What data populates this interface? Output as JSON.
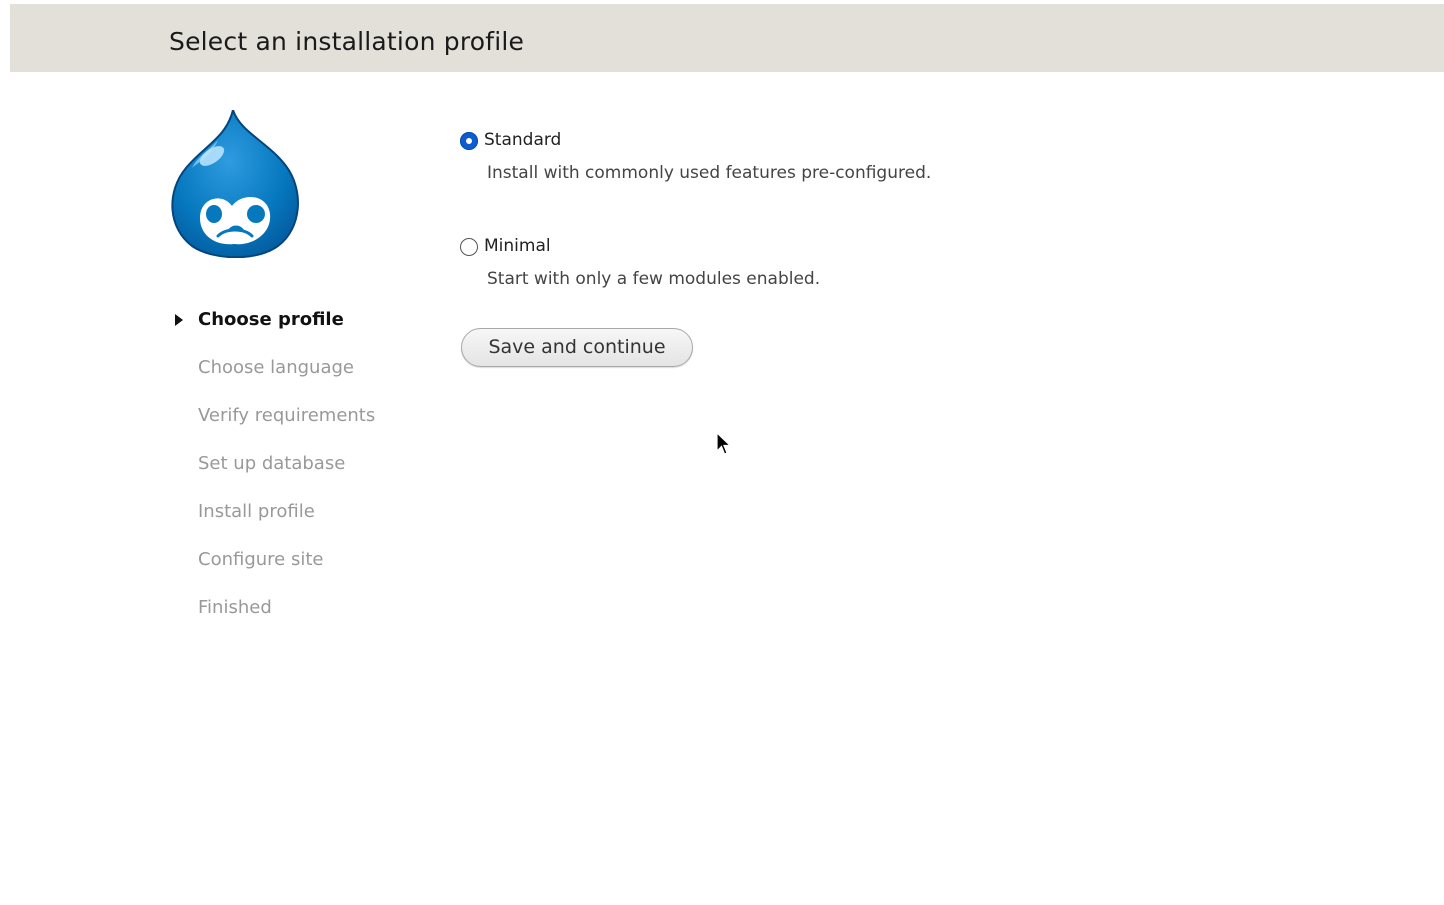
{
  "header": {
    "title": "Select an installation profile"
  },
  "logo": {
    "icon": "drupal-drop-logo",
    "color": "#0678be"
  },
  "steps": [
    {
      "label": "Choose profile",
      "active": true
    },
    {
      "label": "Choose language",
      "active": false
    },
    {
      "label": "Verify requirements",
      "active": false
    },
    {
      "label": "Set up database",
      "active": false
    },
    {
      "label": "Install profile",
      "active": false
    },
    {
      "label": "Configure site",
      "active": false
    },
    {
      "label": "Finished",
      "active": false
    }
  ],
  "profiles": [
    {
      "label": "Standard",
      "description": "Install with commonly used features pre-configured.",
      "selected": true
    },
    {
      "label": "Minimal",
      "description": "Start with only a few modules enabled.",
      "selected": false
    }
  ],
  "actions": {
    "save_label": "Save and continue"
  },
  "colors": {
    "header_bg": "#e3e0d9",
    "radio_selected": "#0f5ccf",
    "step_inactive": "#999999"
  }
}
